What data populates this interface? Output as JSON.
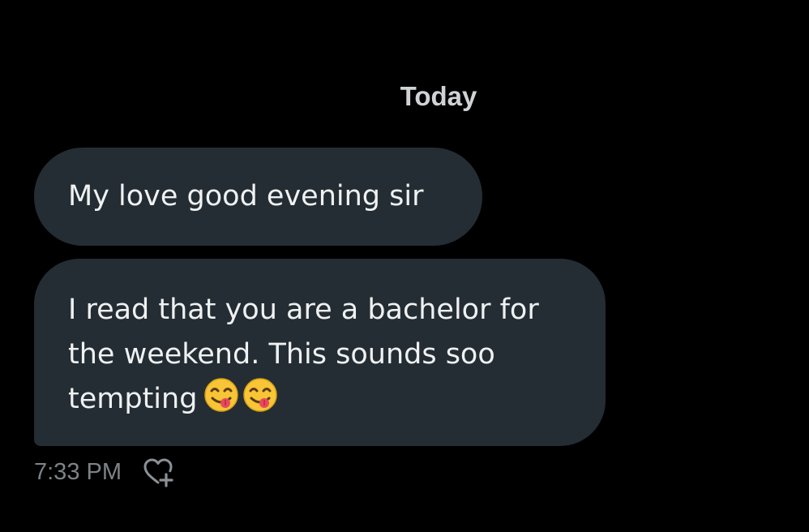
{
  "conversation": {
    "date_divider": "Today",
    "messages": [
      {
        "text": "My love good evening sir"
      },
      {
        "text": "I read that you are a bachelor for\nthe weekend. This sounds soo\ntempting",
        "emojis": [
          "face-savoring-food-emoji",
          "face-savoring-food-emoji"
        ]
      }
    ],
    "timestamp": "7:33 PM",
    "reaction_icon": "heart-plus-icon"
  },
  "colors": {
    "background": "#000000",
    "bubble": "#242d34",
    "text": "#eff1f2",
    "timestamp": "#7c8388"
  }
}
